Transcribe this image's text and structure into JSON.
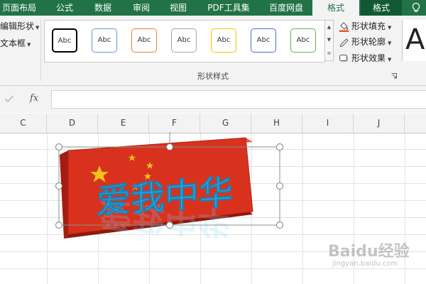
{
  "tabs": [
    {
      "label": "页面布局",
      "active": false
    },
    {
      "label": "公式",
      "active": false
    },
    {
      "label": "数据",
      "active": false
    },
    {
      "label": "审阅",
      "active": false
    },
    {
      "label": "视图",
      "active": false
    },
    {
      "label": "PDF工具集",
      "active": false
    },
    {
      "label": "百度网盘",
      "active": false
    },
    {
      "label": "格式",
      "active": true
    },
    {
      "label": "格式",
      "active": false
    }
  ],
  "ribbon": {
    "left_commands": [
      {
        "label": "编辑形状"
      },
      {
        "label": "文本框"
      }
    ],
    "shape_styles_group": {
      "label": "形状样式",
      "swatches": [
        {
          "text": "Abc",
          "border_color": "#000000"
        },
        {
          "text": "Abc",
          "border_color": "#5b9bd5"
        },
        {
          "text": "Abc",
          "border_color": "#ed7d31"
        },
        {
          "text": "Abc",
          "border_color": "#a5a5a5"
        },
        {
          "text": "Abc",
          "border_color": "#ffc000"
        },
        {
          "text": "Abc",
          "border_color": "#4472c4"
        },
        {
          "text": "Abc",
          "border_color": "#70ad47"
        }
      ],
      "commands": [
        {
          "label": "形状填充",
          "icon": "paint-bucket-icon"
        },
        {
          "label": "形状轮廓",
          "icon": "pen-outline-icon"
        },
        {
          "label": "形状效果",
          "icon": "shape-effects-icon"
        }
      ]
    },
    "wordart_preview_letter": "A"
  },
  "formula_bar": {
    "fx_label": "fx",
    "value": ""
  },
  "columns": [
    "C",
    "D",
    "E",
    "F",
    "G",
    "H",
    "I",
    "J"
  ],
  "shape": {
    "text": "爱我中华",
    "fill_color": "#d8321f",
    "text_color": "#2aa7e0",
    "star_color": "#f3c21a"
  },
  "watermark": {
    "main": "Baidu经验",
    "sub": "jingyan.baidu.com"
  },
  "colors": {
    "accent": "#217346",
    "ribbon_bg": "#f3f3f3"
  }
}
